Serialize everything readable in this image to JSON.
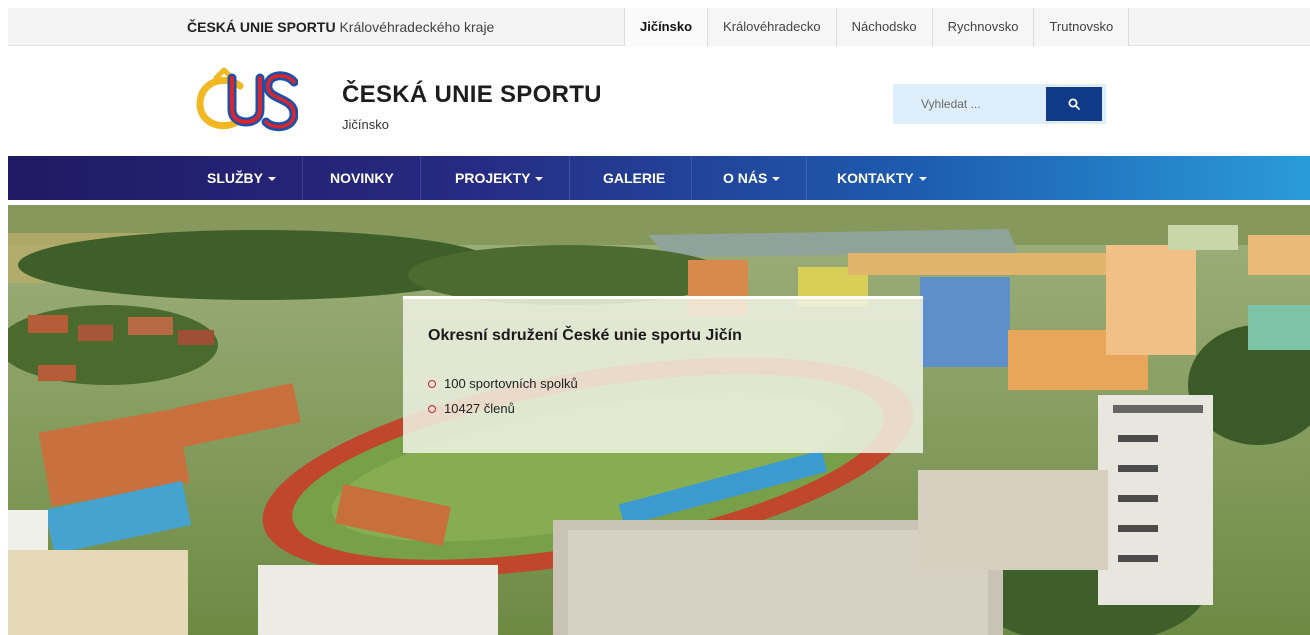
{
  "topbar": {
    "brand_bold": "ČESKÁ UNIE SPORTU",
    "brand_rest": "Královéhradeckého kraje",
    "regions": [
      {
        "label": "Jičínsko",
        "active": true
      },
      {
        "label": "Královéhradecko",
        "active": false
      },
      {
        "label": "Náchodsko",
        "active": false
      },
      {
        "label": "Rychnovsko",
        "active": false
      },
      {
        "label": "Trutnovsko",
        "active": false
      }
    ]
  },
  "header": {
    "title": "ČESKÁ UNIE SPORTU",
    "subtitle": "Jičínsko",
    "logo_icon": "cus-logo-icon"
  },
  "search": {
    "placeholder": "Vyhledat ...",
    "icon": "search-icon"
  },
  "nav": {
    "items": [
      {
        "label": "SLUŽBY",
        "dropdown": true
      },
      {
        "label": "NOVINKY",
        "dropdown": false
      },
      {
        "label": "PROJEKTY",
        "dropdown": true
      },
      {
        "label": "GALERIE",
        "dropdown": false
      },
      {
        "label": "O NÁS",
        "dropdown": true
      },
      {
        "label": "KONTAKTY",
        "dropdown": true
      }
    ]
  },
  "hero": {
    "card_title": "Okresní sdružení České unie sportu Jičín",
    "facts": [
      "100 sportovních spolků",
      "10427 členů"
    ]
  },
  "colors": {
    "nav_start": "#1f1a63",
    "nav_end": "#2a9bd9",
    "search_button": "#0e3a87",
    "bullet": "#c8232c"
  }
}
